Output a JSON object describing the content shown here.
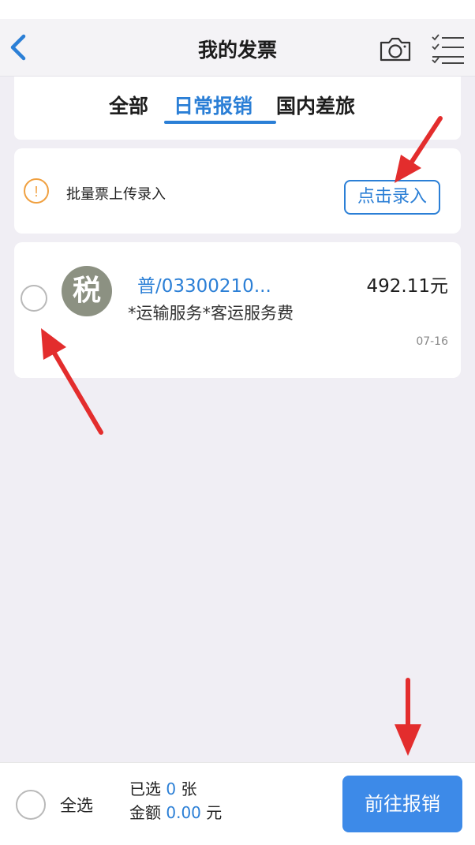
{
  "header": {
    "title": "我的发票"
  },
  "tabs": [
    {
      "label": "全部"
    },
    {
      "label": "日常报销"
    },
    {
      "label": "国内差旅"
    }
  ],
  "batch": {
    "text": "批量票上传录入",
    "button_label": "点击录入",
    "warn_symbol": "!"
  },
  "invoices": [
    {
      "avatar_text": "税",
      "number": "普/03300210...",
      "amount": "492.11元",
      "description": "*运输服务*客运服务费",
      "date": "07-16"
    }
  ],
  "footer": {
    "select_all_label": "全选",
    "selected_prefix": "已选",
    "selected_count": "0",
    "selected_suffix": "张",
    "amount_prefix": "金额",
    "amount_value": "0.00",
    "amount_suffix": "元",
    "go_button_label": "前往报销"
  },
  "colors": {
    "accent": "#2b7fd6",
    "primary_button": "#3d8ae8",
    "warning": "#f0a040",
    "annotation_arrow": "#e32d2d",
    "background": "#f0eef4"
  },
  "icons": [
    "back-arrow-icon",
    "camera-icon",
    "checklist-icon",
    "warning-icon",
    "tax-icon"
  ]
}
